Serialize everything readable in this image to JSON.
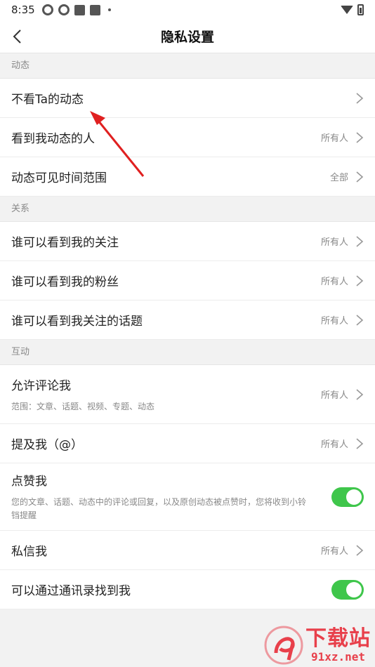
{
  "status_bar": {
    "time": "8:35"
  },
  "header": {
    "title": "隐私设置"
  },
  "sections": [
    {
      "header": "动态",
      "rows": [
        {
          "title": "不看Ta的动态",
          "value": ""
        },
        {
          "title": "看到我动态的人",
          "value": "所有人"
        },
        {
          "title": "动态可见时间范围",
          "value": "全部"
        }
      ]
    },
    {
      "header": "关系",
      "rows": [
        {
          "title": "谁可以看到我的关注",
          "value": "所有人"
        },
        {
          "title": "谁可以看到我的粉丝",
          "value": "所有人"
        },
        {
          "title": "谁可以看到我关注的话题",
          "value": "所有人"
        }
      ]
    },
    {
      "header": "互动",
      "rows": [
        {
          "title": "允许评论我",
          "subtitle": "范围：文章、话题、视频、专题、动态",
          "value": "所有人"
        },
        {
          "title": "提及我（@）",
          "value": "所有人"
        },
        {
          "title": "点赞我",
          "subtitle": "您的文章、话题、动态中的评论或回复，以及原创动态被点赞时，您将收到小铃铛提醒",
          "toggle": true
        },
        {
          "title": "私信我",
          "value": "所有人"
        },
        {
          "title": "可以通过通讯录找到我",
          "toggle": true
        }
      ]
    }
  ],
  "watermark": {
    "title": "下载站",
    "domain": "91xz.net"
  },
  "colors": {
    "toggle_on": "#3fc64b",
    "arrow": "#e02020",
    "watermark": "#e8404b"
  }
}
